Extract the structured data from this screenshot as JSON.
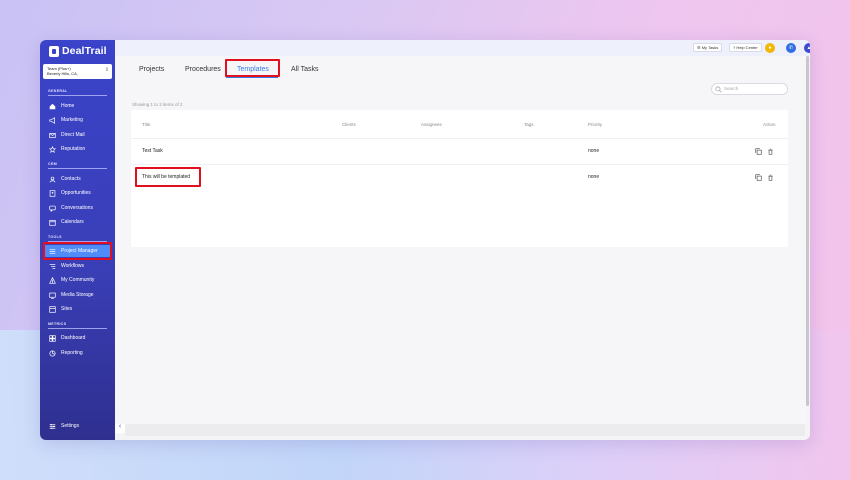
{
  "app": {
    "name": "DealTrail"
  },
  "team": {
    "line1": "Team (Plus+)",
    "line2": "Beverly Hills, CA,"
  },
  "sidebar": {
    "sections": [
      {
        "label": "GENERAL"
      },
      {
        "label": "CRM"
      },
      {
        "label": "TOOLS"
      },
      {
        "label": "METRICS"
      }
    ],
    "items": [
      {
        "label": "Home",
        "icon": "home-icon"
      },
      {
        "label": "Marketing",
        "icon": "megaphone-icon"
      },
      {
        "label": "Direct Mail",
        "icon": "mail-icon"
      },
      {
        "label": "Reputation",
        "icon": "star-icon"
      },
      {
        "label": "Contacts",
        "icon": "contacts-icon"
      },
      {
        "label": "Opportunities",
        "icon": "opportunities-icon"
      },
      {
        "label": "Conversations",
        "icon": "chat-icon"
      },
      {
        "label": "Calendars",
        "icon": "calendar-icon"
      },
      {
        "label": "Project Manager",
        "icon": "list-icon"
      },
      {
        "label": "Workflows",
        "icon": "workflow-icon"
      },
      {
        "label": "My Community",
        "icon": "community-icon"
      },
      {
        "label": "Media Storage",
        "icon": "media-icon"
      },
      {
        "label": "Sites",
        "icon": "sites-icon"
      },
      {
        "label": "Dashboard",
        "icon": "dashboard-icon"
      },
      {
        "label": "Reporting",
        "icon": "reporting-icon"
      }
    ],
    "settings": "Settings"
  },
  "topbar": {
    "my_tasks": "☰ My Tasks",
    "help_center": "? Help Center",
    "help_q": "?"
  },
  "tabs": [
    {
      "label": "Projects"
    },
    {
      "label": "Procedures"
    },
    {
      "label": "Templates"
    },
    {
      "label": "All Tasks"
    }
  ],
  "search": {
    "placeholder": "Search"
  },
  "showing": "Showing 1 to 2 items of 2",
  "table": {
    "columns": [
      "Title",
      "Clients",
      "Assignees",
      "Tags",
      "Priority",
      "Action"
    ],
    "rows": [
      {
        "title": "Test Task",
        "priority": "none"
      },
      {
        "title": "This will be templated",
        "priority": "none"
      }
    ]
  },
  "colors": {
    "accent": "#3b7be8",
    "sidebar": "#3a43c9",
    "highlight": "#e0101e",
    "active_item": "#4f8cf7"
  }
}
